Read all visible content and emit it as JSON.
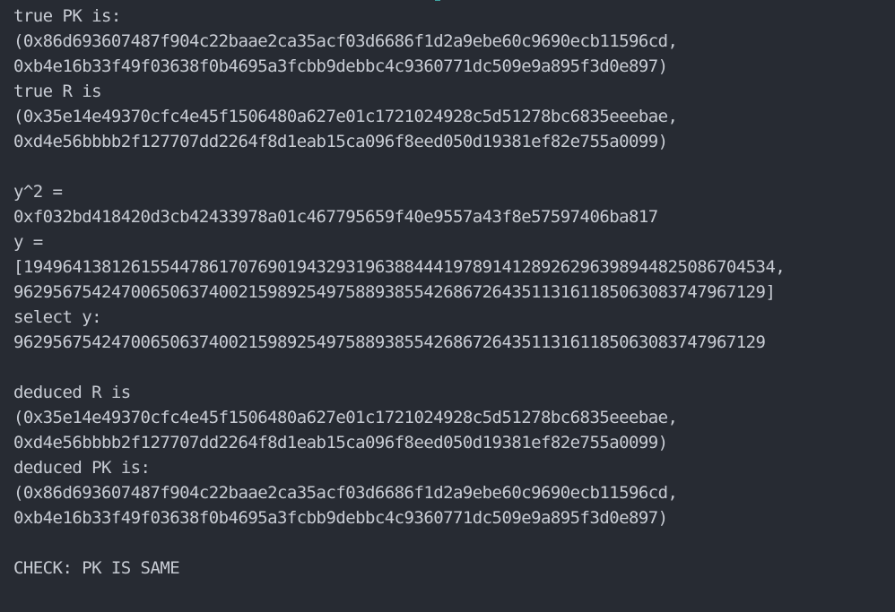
{
  "lines": [
    "true PK is:",
    "(0x86d693607487f904c22baae2ca35acf03d6686f1d2a9ebe60c9690ecb11596cd,",
    "0xb4e16b33f49f03638f0b4695a3fcbb9debbc4c9360771dc509e9a895f3d0e897)",
    "true R is",
    "(0x35e14e49370cfc4e45f1506480a627e01c1721024928c5d51278bc6835eeebae,",
    "0xd4e56bbbb2f127707dd2264f8d1eab15ca096f8eed050d19381ef82e755a0099)",
    "",
    "y^2 =",
    "0xf032bd418420d3cb42433978a01c467795659f40e9557a43f8e57597406ba817",
    "y =",
    "[19496413812615544786170769019432931963884441978914128926296398944825086704534,",
    "96295675424700650637400215989254975889385542686726435113161185063083747967129]",
    "select y:",
    "96295675424700650637400215989254975889385542686726435113161185063083747967129",
    "",
    "deduced R is",
    "(0x35e14e49370cfc4e45f1506480a627e01c1721024928c5d51278bc6835eeebae,",
    "0xd4e56bbbb2f127707dd2264f8d1eab15ca096f8eed050d19381ef82e755a0099)",
    "deduced PK is:",
    "(0x86d693607487f904c22baae2ca35acf03d6686f1d2a9ebe60c9690ecb11596cd,",
    "0xb4e16b33f49f03638f0b4695a3fcbb9debbc4c9360771dc509e9a895f3d0e897)",
    "",
    "CHECK: PK IS SAME"
  ],
  "colors": {
    "background": "#272b33",
    "text": "#c8ccd4",
    "accent": "#3fa3a1"
  }
}
